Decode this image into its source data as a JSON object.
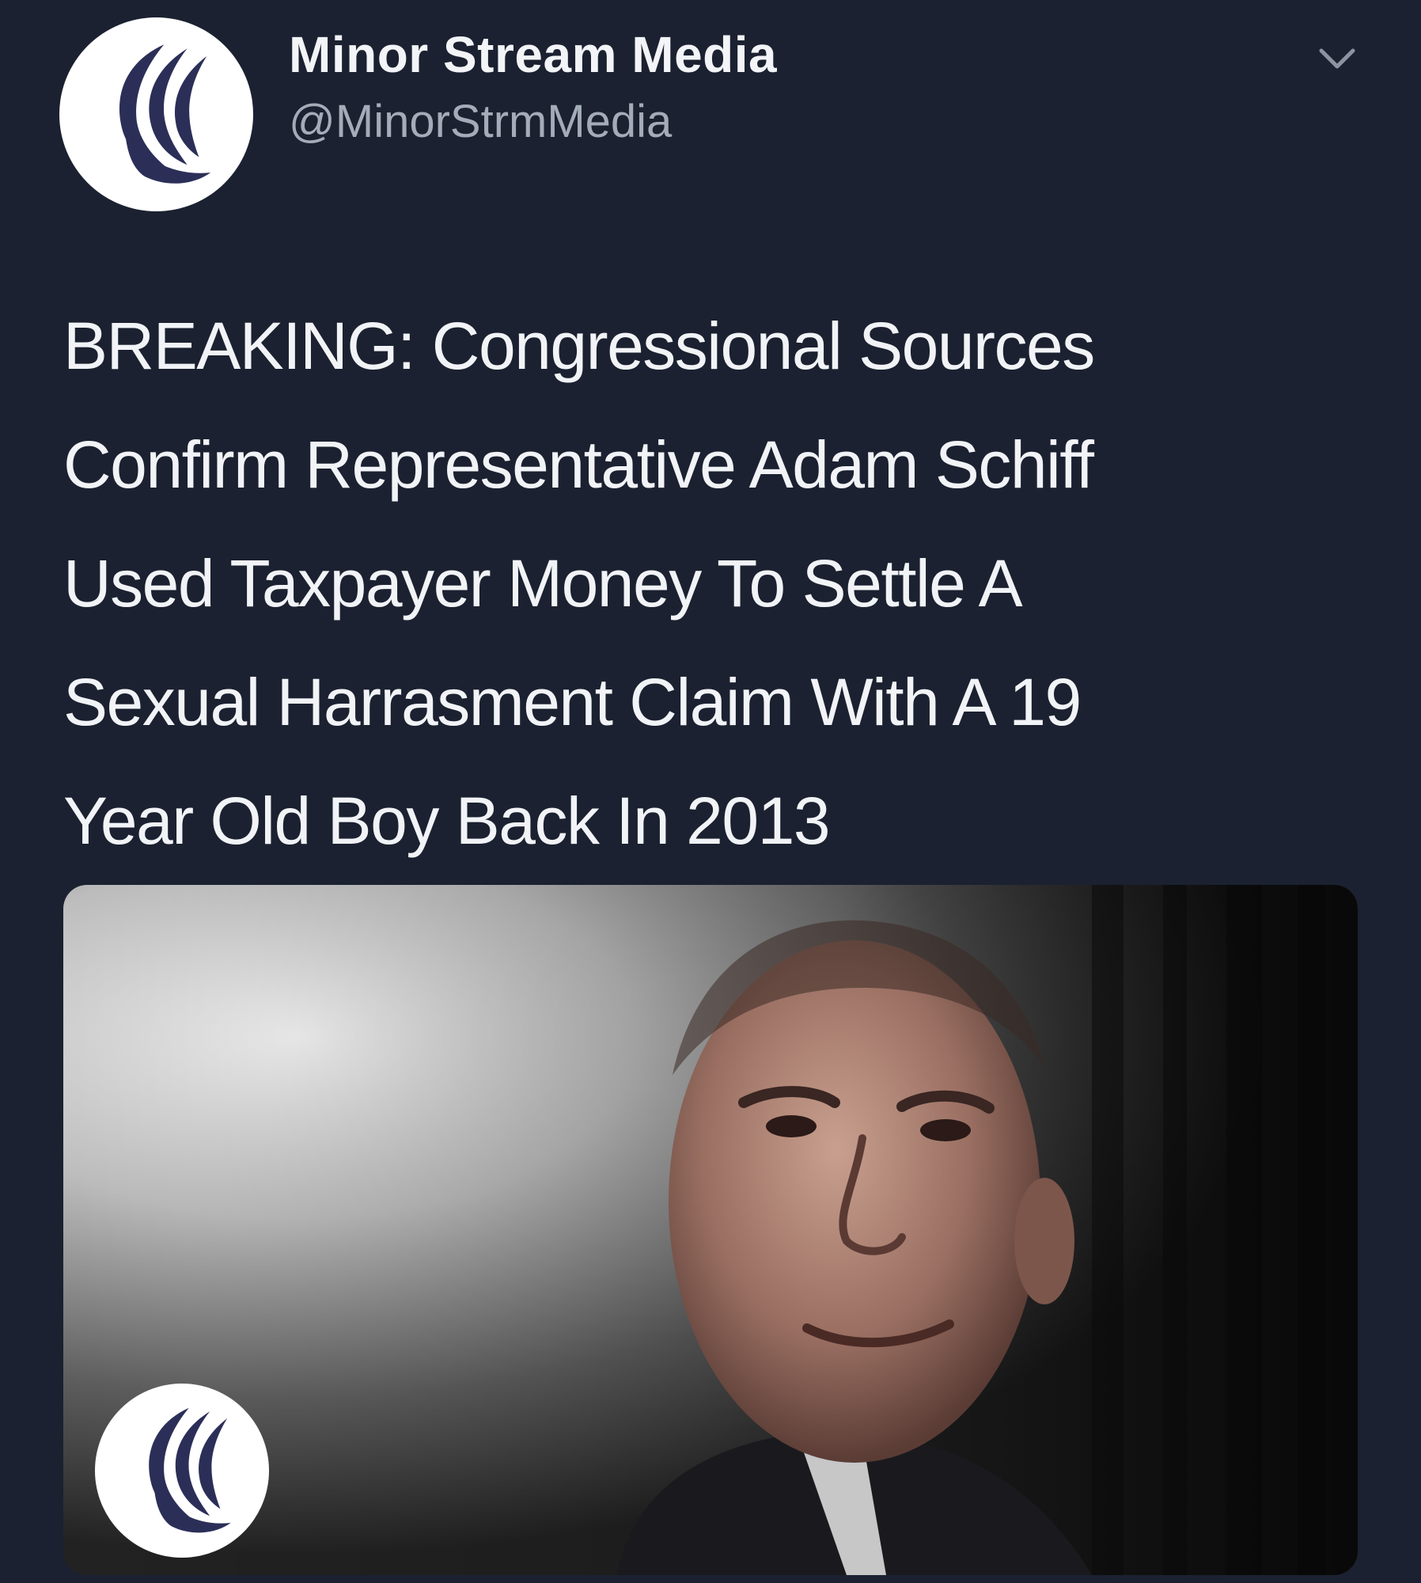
{
  "account": {
    "display_name": "Minor Stream Media",
    "handle": "@MinorStrmMedia",
    "avatar_icon": "swoosh-logo-icon",
    "more_icon": "chevron-down-icon"
  },
  "tweet": {
    "text_lines": [
      "BREAKING: Congressional Sources",
      "Confirm Representative Adam Schiff",
      "Used Taxpayer Money To Settle A",
      "Sexual Harrasment Claim With A 19",
      "Year Old Boy Back In 2013"
    ]
  },
  "media": {
    "badge_icon": "swoosh-logo-icon"
  },
  "colors": {
    "background": "#1b2130",
    "text": "#f1f3f6",
    "handle": "#a3acb8",
    "logo": "#2b2f58"
  }
}
